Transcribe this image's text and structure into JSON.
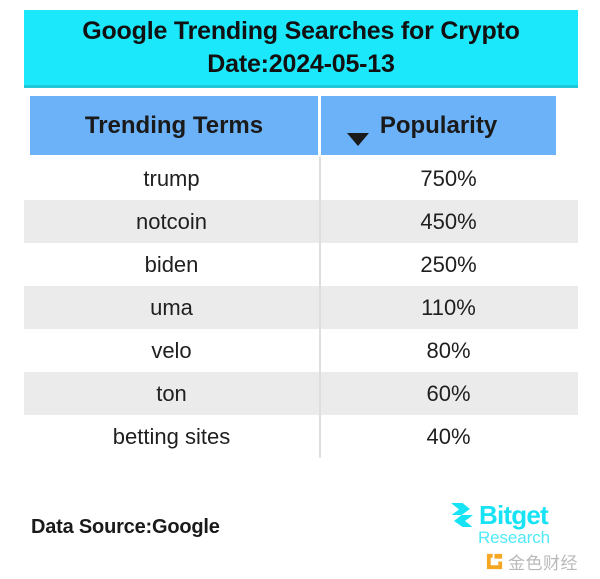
{
  "title": {
    "line1": "Google Trending Searches for Crypto",
    "line2": "Date:2024-05-13"
  },
  "table": {
    "columns": [
      "Trending Terms",
      "Popularity"
    ],
    "sort_indicator": "descending",
    "rows": [
      {
        "term": "trump",
        "popularity": "750%"
      },
      {
        "term": "notcoin",
        "popularity": "450%"
      },
      {
        "term": "biden",
        "popularity": "250%"
      },
      {
        "term": "uma",
        "popularity": "110%"
      },
      {
        "term": "velo",
        "popularity": "80%"
      },
      {
        "term": "ton",
        "popularity": "60%"
      },
      {
        "term": "betting sites",
        "popularity": "40%"
      }
    ]
  },
  "footer": {
    "data_source": "Data Source:Google",
    "brand": "Bitget",
    "brand_sub": "Research",
    "watermark": "金色财经"
  },
  "colors": {
    "title_banner": "#1ce8fc",
    "header_blue": "#6cb2f8",
    "row_alt": "#ebebeb",
    "brand_cyan": "#17e3f5",
    "watermark_orange": "#f5a623"
  },
  "chart_data": {
    "type": "table",
    "title": "Google Trending Searches for Crypto — Date:2024-05-13",
    "xlabel": "Trending Terms",
    "ylabel": "Popularity",
    "categories": [
      "trump",
      "notcoin",
      "biden",
      "uma",
      "velo",
      "ton",
      "betting sites"
    ],
    "values": [
      750,
      450,
      250,
      110,
      80,
      60,
      40
    ],
    "value_unit": "%",
    "sorted": "descending by popularity",
    "source": "Google"
  }
}
